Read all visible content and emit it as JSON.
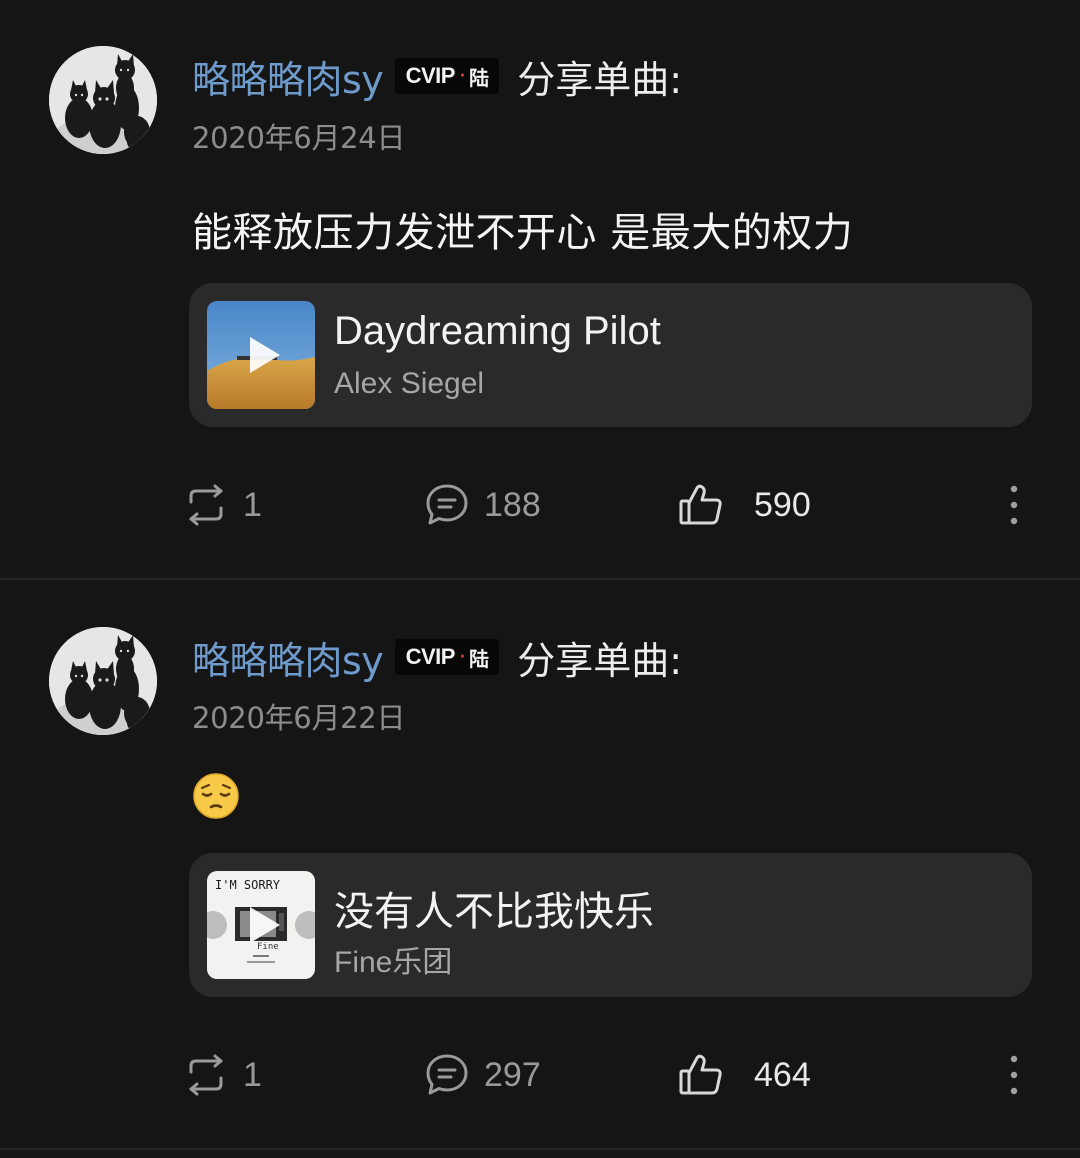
{
  "posts": [
    {
      "username": "略略略肉sy",
      "vip": {
        "text": "CVIP",
        "dot": "·",
        "level": "陆"
      },
      "share_label": "分享单曲:",
      "date": "2020年6月24日",
      "text": "能释放压力发泄不开心 是最大的权力",
      "song": {
        "title": "Daydreaming Pilot",
        "artist": "Alex Siegel"
      },
      "stats": {
        "reposts": "1",
        "comments": "188",
        "likes": "590"
      }
    },
    {
      "username": "略略略肉sy",
      "vip": {
        "text": "CVIP",
        "dot": "·",
        "level": "陆"
      },
      "share_label": "分享单曲:",
      "date": "2020年6月22日",
      "emoji": "pensive-face",
      "song": {
        "title": "没有人不比我快乐",
        "artist": "Fine乐团",
        "cover_text": "I'M SORRY"
      },
      "stats": {
        "reposts": "1",
        "comments": "297",
        "likes": "464"
      }
    }
  ],
  "colors": {
    "background": "#151515",
    "username": "#6e9bcb",
    "card": "#2a2a2a",
    "date": "#8c8c8c"
  }
}
